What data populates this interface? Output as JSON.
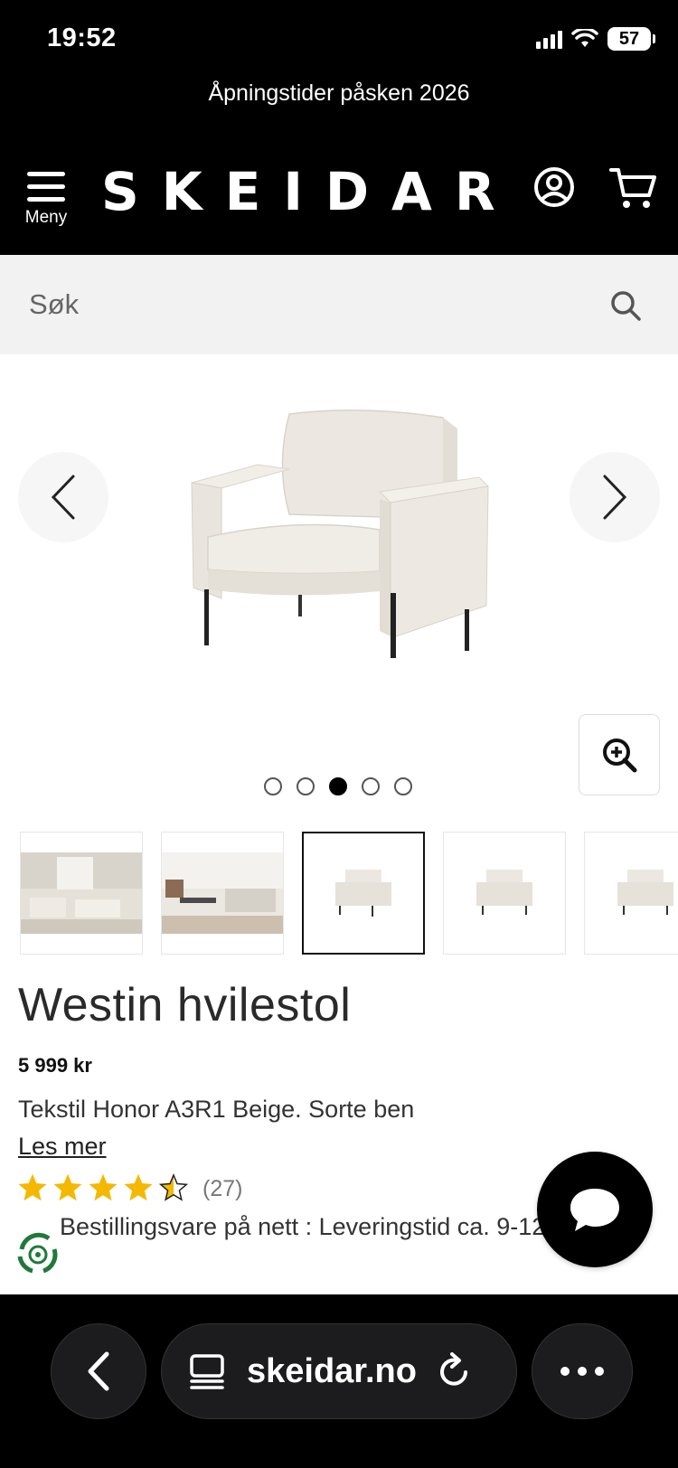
{
  "status_bar": {
    "time": "19:52",
    "battery": "57"
  },
  "promo": {
    "text": "Åpningstider påsken 2026"
  },
  "header": {
    "menu_label": "Meny",
    "logo": "SKEIDAR"
  },
  "search": {
    "placeholder": "Søk"
  },
  "gallery": {
    "total_images": 5,
    "active_index": 3
  },
  "product": {
    "title": "Westin hvilestol",
    "price": "5 999 kr",
    "variant": "Tekstil Honor A3R1 Beige. Sorte ben",
    "read_more": "Les mer",
    "rating_value": 4.5,
    "rating_count": "(27)",
    "delivery": "Bestillingsvare på nett : Leveringstid ca. 9-12 uker"
  },
  "browser": {
    "url": "skeidar.no"
  },
  "colors": {
    "brand_black": "#000000",
    "star": "#f5b800",
    "search_bg": "#f2f2f2"
  },
  "icons": [
    "hamburger-icon",
    "user-icon",
    "cart-icon",
    "search-icon",
    "chevron-left-icon",
    "chevron-right-icon",
    "zoom-in-icon",
    "star-icon",
    "chat-icon",
    "eco-badge-icon",
    "reader-icon",
    "reload-icon",
    "more-icon"
  ]
}
